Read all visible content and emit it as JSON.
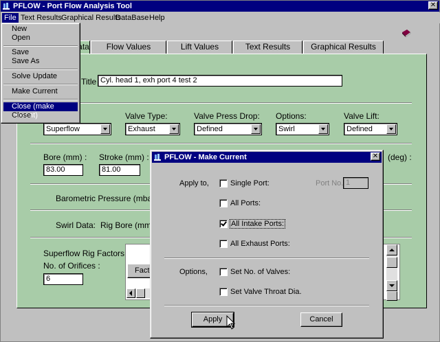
{
  "window": {
    "title": "PFLOW - Port Flow Analysis Tool"
  },
  "menubar": {
    "items": [
      "File",
      "Text Results",
      "Graphical Results",
      "DataBase",
      "Help"
    ]
  },
  "file_menu": {
    "items": [
      "New",
      "Open",
      "Save",
      "Save As",
      "Solve Update",
      "Make Current",
      "Close (make current)",
      "Close"
    ],
    "selected": "Close (make current)"
  },
  "tabs": [
    "Data",
    "Flow Values",
    "Lift Values",
    "Text Results",
    "Graphical Results"
  ],
  "tab_data_partial": "ata",
  "form": {
    "title_label": "Title",
    "title_value": "Cyl. head 1, exh port 4 test 2",
    "rig_type_value": "Superflow",
    "valve_type_label": "Valve Type:",
    "valve_type_value": "Exhaust",
    "valve_press_drop_label": "Valve Press Drop:",
    "valve_press_drop_value": "Defined",
    "options_label": "Options:",
    "options_value": "Swirl",
    "valve_lift_label": "Valve Lift:",
    "valve_lift_value": "Defined",
    "bore_label": "Bore (mm) :",
    "bore_value": "83.00",
    "stroke_label": "Stroke (mm) :",
    "stroke_value": "81.00",
    "deg_label": "(deg) :",
    "baro_label": "Barometric Pressure (mbar)",
    "swirl_label": "Swirl Data:",
    "rig_bore_label": "Rig Bore (mm)",
    "superflow_label": "Superflow Rig Factors:",
    "orifices_label": "No. of Orifices :",
    "orifices_value": "6",
    "factor_partial": "Facto"
  },
  "dialog": {
    "title": "PFLOW - Make Current",
    "apply_to_label": "Apply to,",
    "options_label": "Options,",
    "port_no_label": "Port No.",
    "port_no_value": "1",
    "checks": [
      {
        "label": "Single Port:",
        "checked": false
      },
      {
        "label": "All Ports:",
        "checked": false
      },
      {
        "label": "All Intake Ports:",
        "checked": true
      },
      {
        "label": "All Exhaust Ports:",
        "checked": false
      },
      {
        "label": "Set No. of Valves:",
        "checked": false
      },
      {
        "label": "Set Valve Throat Dia.",
        "checked": false
      }
    ],
    "apply_label": "Apply",
    "cancel_label": "Cancel"
  },
  "colors": {
    "titlebar": "#000080",
    "panel_green": "#a8cca8",
    "face": "#c0c0c0"
  }
}
